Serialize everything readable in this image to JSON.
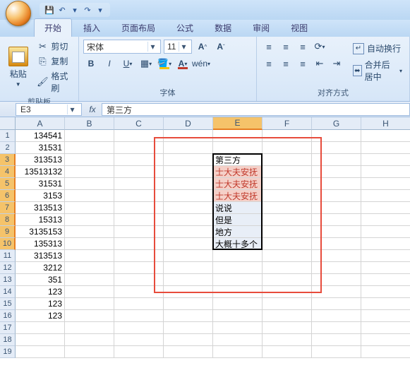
{
  "qat": {
    "save": "💾",
    "undo": "↶",
    "redo": "↷",
    "more": "▾",
    "sep": "▾"
  },
  "tabs": [
    "开始",
    "插入",
    "页面布局",
    "公式",
    "数据",
    "审阅",
    "视图"
  ],
  "active_tab": 0,
  "clipboard": {
    "paste": "粘贴",
    "cut": "剪切",
    "copy": "复制",
    "format": "格式刷",
    "title": "剪贴板"
  },
  "font": {
    "name": "宋体",
    "size": "11",
    "grow": "A",
    "shrink": "A",
    "bold": "B",
    "italic": "I",
    "underline": "U",
    "title": "字体"
  },
  "align": {
    "wrap": "自动换行",
    "merge": "合并后居中",
    "title": "对齐方式"
  },
  "namebox": "E3",
  "formula": "第三方",
  "columns": [
    "A",
    "B",
    "C",
    "D",
    "E",
    "F",
    "G",
    "H"
  ],
  "row_count": 19,
  "colA": [
    "134541",
    "31531",
    "313513",
    "13513132",
    "31531",
    "3153",
    "313513",
    "15313",
    "3135153",
    "135313",
    "313513",
    "3212",
    "351",
    "123",
    "123",
    "123"
  ],
  "colE": {
    "3": "第三方",
    "4": "士大夫安抚",
    "5": "士大夫安抚",
    "6": "士大夫安抚",
    "7": "说说",
    "8": "但是",
    "9": "地方",
    "10": "大概十多个"
  },
  "red_rows": [
    4,
    5,
    6
  ],
  "selection": {
    "col": "E",
    "r1": 3,
    "r2": 10,
    "active": 3
  },
  "chart_data": null
}
